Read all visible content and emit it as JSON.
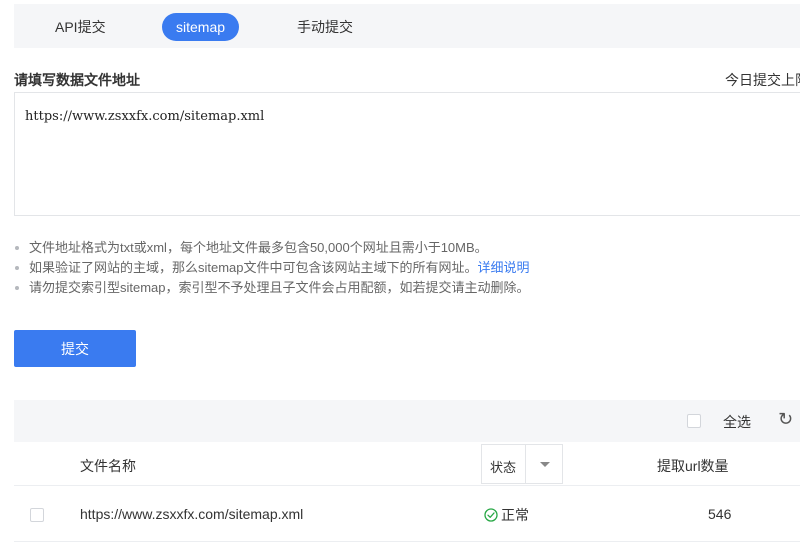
{
  "tabs": [
    {
      "label": "API提交",
      "active": false
    },
    {
      "label": "sitemap",
      "active": true
    },
    {
      "label": "手动提交",
      "active": false
    }
  ],
  "form": {
    "label": "请填写数据文件地址",
    "quota_text": "今日提交上限",
    "textarea_value": "https://www.zsxxfx.com/sitemap.xml"
  },
  "notes": {
    "line1": "文件地址格式为txt或xml，每个地址文件最多包含50,000个网址且需小于10MB。",
    "line2": "如果验证了网站的主域，那么sitemap文件中可包含该网站主域下的所有网址。",
    "line2_link": "详细说明",
    "line3": "请勿提交索引型sitemap，索引型不予处理且子文件会占用配额，如若提交请主动删除。"
  },
  "submit_label": "提交",
  "toolbar": {
    "select_all": "全选",
    "refresh_icon": "refresh-icon"
  },
  "table": {
    "columns": [
      "文件名称",
      "状态",
      "提取url数量"
    ],
    "rows": [
      {
        "url": "https://www.zsxxfx.com/sitemap.xml",
        "status": "正常",
        "count": "546"
      }
    ]
  },
  "colors": {
    "accent": "#3a7bf0",
    "ok": "#27a745"
  }
}
